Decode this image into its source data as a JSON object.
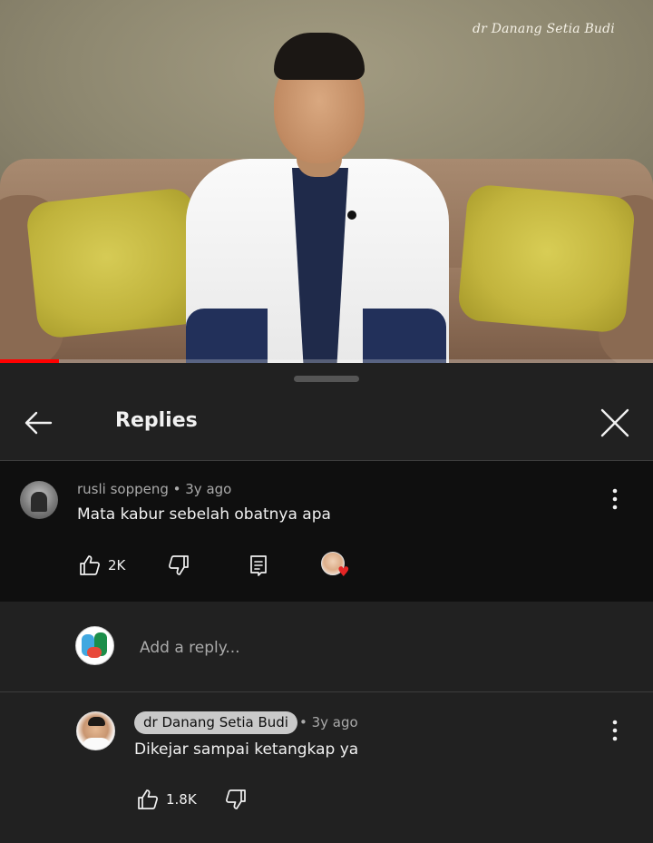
{
  "video": {
    "watermark": "dr Danang Setia Budi",
    "progress": 0.09,
    "progress_color": "#ff0000"
  },
  "header": {
    "title": "Replies",
    "back_icon": "arrow-left-icon",
    "close_icon": "close-icon"
  },
  "parent_comment": {
    "author": "rusli soppeng",
    "time": "3y ago",
    "meta": "rusli soppeng • 3y ago",
    "text": "Mata kabur sebelah obatnya apa",
    "likes": "2K",
    "icons": [
      "thumb-up-icon",
      "thumb-down-icon",
      "reply-icon",
      "creator-heart-icon",
      "more-vert-icon"
    ]
  },
  "reply_box": {
    "placeholder": "Add a reply..."
  },
  "reply": {
    "author": "dr Danang Setia Budi",
    "time": "• 3y ago",
    "text": "Dikejar sampai ketangkap ya",
    "likes": "1.8K",
    "icons": [
      "thumb-up-icon",
      "thumb-down-icon",
      "more-vert-icon"
    ]
  },
  "colors": {
    "panel_bg": "#212121",
    "highlight_bg": "#0f0f0f",
    "author_chip_bg": "#c9c9c9",
    "heart": "#e52525"
  }
}
